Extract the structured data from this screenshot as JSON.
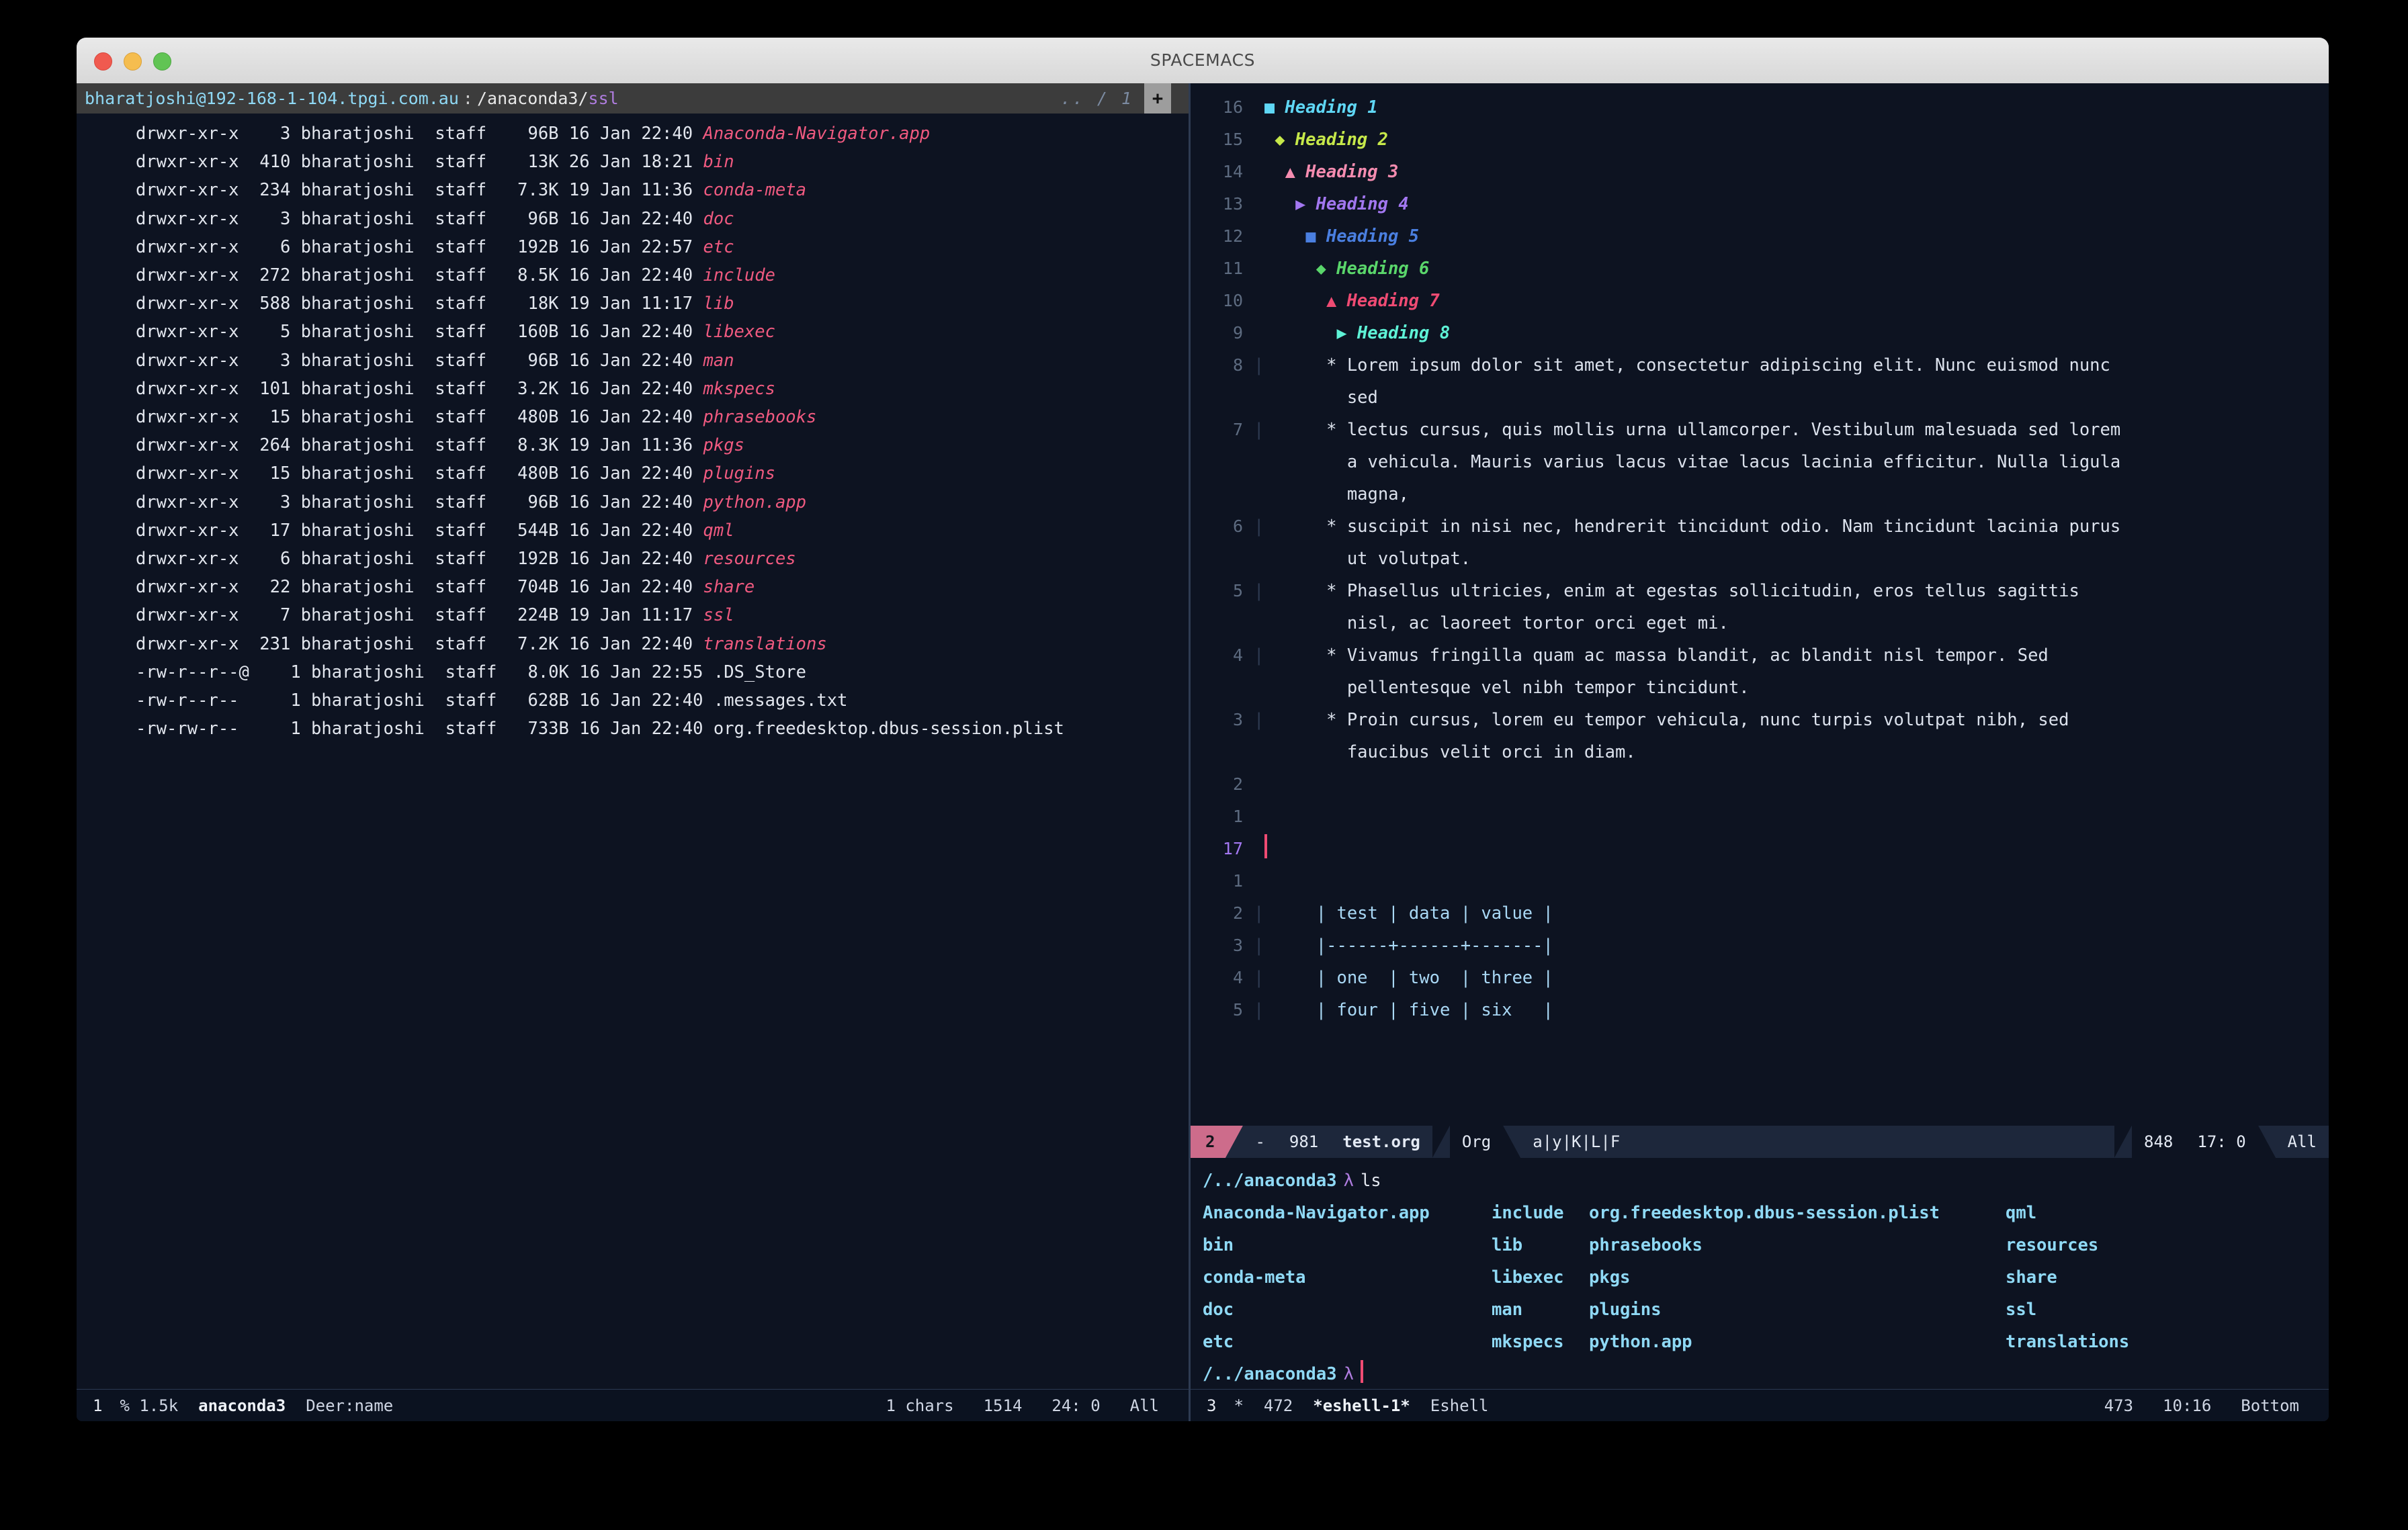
{
  "window": {
    "title": "SPACEMACS",
    "traffic_lights": [
      "close-red",
      "minimize-yellow",
      "maximize-green"
    ]
  },
  "file_manager": {
    "path_user": "bharatjoshi@192-168-1-104.tpgi.com.au",
    "path_separator": ":",
    "path_dir": "/anaconda3/",
    "path_current": "ssl",
    "tab_indicator": ".. / 1",
    "new_tab_label": "+",
    "columns": [
      "permissions",
      "links",
      "owner",
      "group",
      "size",
      "date",
      "name"
    ],
    "rows": [
      {
        "perm": "drwxr-xr-x",
        "links": "  3",
        "owner": "bharatjoshi",
        "group": "staff",
        "size": "  96B",
        "date": "16 Jan 22:40",
        "name": "Anaconda-Navigator.app",
        "dir": true
      },
      {
        "perm": "drwxr-xr-x",
        "links": "410",
        "owner": "bharatjoshi",
        "group": "staff",
        "size": "  13K",
        "date": "26 Jan 18:21",
        "name": "bin",
        "dir": true
      },
      {
        "perm": "drwxr-xr-x",
        "links": "234",
        "owner": "bharatjoshi",
        "group": "staff",
        "size": " 7.3K",
        "date": "19 Jan 11:36",
        "name": "conda-meta",
        "dir": true
      },
      {
        "perm": "drwxr-xr-x",
        "links": "  3",
        "owner": "bharatjoshi",
        "group": "staff",
        "size": "  96B",
        "date": "16 Jan 22:40",
        "name": "doc",
        "dir": true
      },
      {
        "perm": "drwxr-xr-x",
        "links": "  6",
        "owner": "bharatjoshi",
        "group": "staff",
        "size": " 192B",
        "date": "16 Jan 22:57",
        "name": "etc",
        "dir": true
      },
      {
        "perm": "drwxr-xr-x",
        "links": "272",
        "owner": "bharatjoshi",
        "group": "staff",
        "size": " 8.5K",
        "date": "16 Jan 22:40",
        "name": "include",
        "dir": true
      },
      {
        "perm": "drwxr-xr-x",
        "links": "588",
        "owner": "bharatjoshi",
        "group": "staff",
        "size": "  18K",
        "date": "19 Jan 11:17",
        "name": "lib",
        "dir": true
      },
      {
        "perm": "drwxr-xr-x",
        "links": "  5",
        "owner": "bharatjoshi",
        "group": "staff",
        "size": " 160B",
        "date": "16 Jan 22:40",
        "name": "libexec",
        "dir": true
      },
      {
        "perm": "drwxr-xr-x",
        "links": "  3",
        "owner": "bharatjoshi",
        "group": "staff",
        "size": "  96B",
        "date": "16 Jan 22:40",
        "name": "man",
        "dir": true
      },
      {
        "perm": "drwxr-xr-x",
        "links": "101",
        "owner": "bharatjoshi",
        "group": "staff",
        "size": " 3.2K",
        "date": "16 Jan 22:40",
        "name": "mkspecs",
        "dir": true
      },
      {
        "perm": "drwxr-xr-x",
        "links": " 15",
        "owner": "bharatjoshi",
        "group": "staff",
        "size": " 480B",
        "date": "16 Jan 22:40",
        "name": "phrasebooks",
        "dir": true
      },
      {
        "perm": "drwxr-xr-x",
        "links": "264",
        "owner": "bharatjoshi",
        "group": "staff",
        "size": " 8.3K",
        "date": "19 Jan 11:36",
        "name": "pkgs",
        "dir": true
      },
      {
        "perm": "drwxr-xr-x",
        "links": " 15",
        "owner": "bharatjoshi",
        "group": "staff",
        "size": " 480B",
        "date": "16 Jan 22:40",
        "name": "plugins",
        "dir": true
      },
      {
        "perm": "drwxr-xr-x",
        "links": "  3",
        "owner": "bharatjoshi",
        "group": "staff",
        "size": "  96B",
        "date": "16 Jan 22:40",
        "name": "python.app",
        "dir": true
      },
      {
        "perm": "drwxr-xr-x",
        "links": " 17",
        "owner": "bharatjoshi",
        "group": "staff",
        "size": " 544B",
        "date": "16 Jan 22:40",
        "name": "qml",
        "dir": true
      },
      {
        "perm": "drwxr-xr-x",
        "links": "  6",
        "owner": "bharatjoshi",
        "group": "staff",
        "size": " 192B",
        "date": "16 Jan 22:40",
        "name": "resources",
        "dir": true
      },
      {
        "perm": "drwxr-xr-x",
        "links": " 22",
        "owner": "bharatjoshi",
        "group": "staff",
        "size": " 704B",
        "date": "16 Jan 22:40",
        "name": "share",
        "dir": true
      },
      {
        "perm": "drwxr-xr-x",
        "links": "  7",
        "owner": "bharatjoshi",
        "group": "staff",
        "size": " 224B",
        "date": "19 Jan 11:17",
        "name": "ssl",
        "dir": true
      },
      {
        "perm": "drwxr-xr-x",
        "links": "231",
        "owner": "bharatjoshi",
        "group": "staff",
        "size": " 7.2K",
        "date": "16 Jan 22:40",
        "name": "translations",
        "dir": true
      },
      {
        "perm": "-rw-r--r--@",
        "links": "  1",
        "owner": "bharatjoshi",
        "group": "staff",
        "size": " 8.0K",
        "date": "16 Jan 22:55",
        "name": ".DS_Store",
        "dir": false
      },
      {
        "perm": "-rw-r--r-- ",
        "links": "  1",
        "owner": "bharatjoshi",
        "group": "staff",
        "size": " 628B",
        "date": "16 Jan 22:40",
        "name": ".messages.txt",
        "dir": false
      },
      {
        "perm": "-rw-rw-r-- ",
        "links": "  1",
        "owner": "bharatjoshi",
        "group": "staff",
        "size": " 733B",
        "date": "16 Jan 22:40",
        "name": "org.freedesktop.dbus-session.plist",
        "dir": false
      }
    ],
    "modeline": {
      "window_number": "1",
      "size_indicator": "% 1.5k",
      "buffer_name": "anaconda3",
      "major_mode": "Deer:name",
      "chars": "1 chars",
      "total": "1514",
      "position": "24: 0",
      "scroll": "All"
    }
  },
  "org_buffer": {
    "lines": [
      {
        "num": "16",
        "kind": "heading",
        "level": 1,
        "bullet": "square-bullet",
        "glyph": "■",
        "indent": 0,
        "text": "Heading 1"
      },
      {
        "num": "15",
        "kind": "heading",
        "level": 2,
        "bullet": "diamond-bullet",
        "glyph": "◆",
        "indent": 1,
        "text": "Heading 2"
      },
      {
        "num": "14",
        "kind": "heading",
        "level": 3,
        "bullet": "triangle-bullet",
        "glyph": "▲",
        "indent": 2,
        "text": "Heading 3"
      },
      {
        "num": "13",
        "kind": "heading",
        "level": 4,
        "bullet": "play-bullet",
        "glyph": "▶",
        "indent": 3,
        "text": "Heading 4"
      },
      {
        "num": "12",
        "kind": "heading",
        "level": 5,
        "bullet": "square-bullet",
        "glyph": "■",
        "indent": 4,
        "text": "Heading 5"
      },
      {
        "num": "11",
        "kind": "heading",
        "level": 6,
        "bullet": "diamond-bullet",
        "glyph": "◆",
        "indent": 5,
        "text": "Heading 6"
      },
      {
        "num": "10",
        "kind": "heading",
        "level": 7,
        "bullet": "triangle-bullet",
        "glyph": "▲",
        "indent": 6,
        "text": "Heading 7"
      },
      {
        "num": "9",
        "kind": "heading",
        "level": 8,
        "bullet": "play-bullet",
        "glyph": "▶",
        "indent": 7,
        "text": "Heading 8"
      },
      {
        "num": "8",
        "kind": "body",
        "bar": true,
        "text": "      * Lorem ipsum dolor sit amet, consectetur adipiscing elit. Nunc euismod nunc"
      },
      {
        "num": "",
        "kind": "body",
        "bar": false,
        "text": "        sed"
      },
      {
        "num": "7",
        "kind": "body",
        "bar": true,
        "text": "      * lectus cursus, quis mollis urna ullamcorper. Vestibulum malesuada sed lorem"
      },
      {
        "num": "",
        "kind": "body",
        "bar": false,
        "text": "        a vehicula. Mauris varius lacus vitae lacus lacinia efficitur. Nulla ligula"
      },
      {
        "num": "",
        "kind": "body",
        "bar": false,
        "text": "        magna,"
      },
      {
        "num": "6",
        "kind": "body",
        "bar": true,
        "text": "      * suscipit in nisi nec, hendrerit tincidunt odio. Nam tincidunt lacinia purus"
      },
      {
        "num": "",
        "kind": "body",
        "bar": false,
        "text": "        ut volutpat."
      },
      {
        "num": "5",
        "kind": "body",
        "bar": true,
        "text": "      * Phasellus ultricies, enim at egestas sollicitudin, eros tellus sagittis"
      },
      {
        "num": "",
        "kind": "body",
        "bar": false,
        "text": "        nisl, ac laoreet tortor orci eget mi."
      },
      {
        "num": "4",
        "kind": "body",
        "bar": true,
        "text": "      * Vivamus fringilla quam ac massa blandit, ac blandit nisl tempor. Sed"
      },
      {
        "num": "",
        "kind": "body",
        "bar": false,
        "text": "        pellentesque vel nibh tempor tincidunt."
      },
      {
        "num": "3",
        "kind": "body",
        "bar": true,
        "text": "      * Proin cursus, lorem eu tempor vehicula, nunc turpis volutpat nibh, sed"
      },
      {
        "num": "",
        "kind": "body",
        "bar": false,
        "text": "        faucibus velit orci in diam."
      },
      {
        "num": "2",
        "kind": "body",
        "bar": false,
        "text": ""
      },
      {
        "num": "1",
        "kind": "body",
        "bar": false,
        "text": ""
      },
      {
        "num": "17",
        "kind": "cursor",
        "bar": false,
        "current": true,
        "text": ""
      },
      {
        "num": "1",
        "kind": "body",
        "bar": false,
        "text": ""
      },
      {
        "num": "2",
        "kind": "table",
        "bar": true,
        "text": "     | test | data | value |"
      },
      {
        "num": "3",
        "kind": "table",
        "bar": true,
        "text": "     |------+------+-------|"
      },
      {
        "num": "4",
        "kind": "table",
        "bar": true,
        "text": "     | one  | two  | three |"
      },
      {
        "num": "5",
        "kind": "table",
        "bar": true,
        "text": "     | four | five | six   |"
      }
    ],
    "modeline": {
      "window_number": "2",
      "modified_flag": "-",
      "size": "981",
      "buffer_name": "test.org",
      "major_mode": "Org",
      "minor_modes": "a|y|K|L|F",
      "total": "848",
      "position": "17: 0",
      "scroll": "All"
    }
  },
  "eshell": {
    "prompt": "/../anaconda3",
    "lambda": "λ",
    "command": "ls",
    "output_rows": [
      [
        "Anaconda-Navigator.app",
        "include",
        "org.freedesktop.dbus-session.plist",
        "qml"
      ],
      [
        "bin",
        "lib",
        "phrasebooks",
        "resources"
      ],
      [
        "conda-meta",
        "libexec",
        "pkgs",
        "share"
      ],
      [
        "doc",
        "man",
        "plugins",
        "ssl"
      ],
      [
        "etc",
        "mkspecs",
        "python.app",
        "translations"
      ]
    ],
    "modeline": {
      "window_number": "3",
      "modified_flag": "*",
      "size": "472",
      "buffer_name": "*eshell-1*",
      "major_mode": "Eshell",
      "total": "473",
      "position": "10:16",
      "scroll": "Bottom"
    }
  },
  "colors": {
    "background": "#0d1321",
    "titlebar": "#e4e4e4",
    "pathbar": "#3c3c3c",
    "modeline_active": "#1d273b",
    "modeline_inactive": "#0b1220",
    "window_number_badge": "#cd6c8b",
    "cursor": "#ef4b73",
    "directory": "#f05a80",
    "eshell_item": "#8fd9f5",
    "h1": "#5fd7f5",
    "h2": "#c6e84a",
    "h3": "#f58cb0",
    "h4": "#a277f0",
    "h5": "#4a7fe0",
    "h6": "#5ad66b",
    "h7": "#ef4b73",
    "h8": "#5ef2d6"
  }
}
